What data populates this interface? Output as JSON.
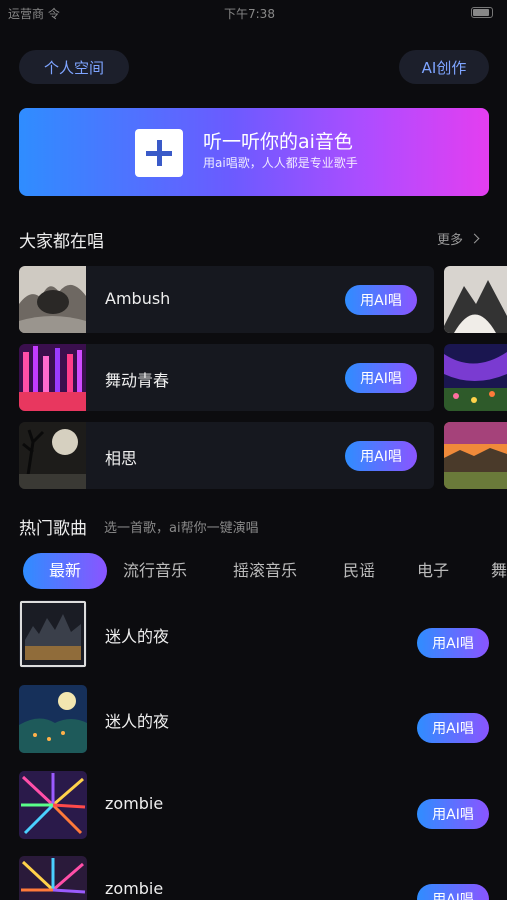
{
  "status_bar": {
    "carrier": "运营商 令",
    "time": "下午7:38"
  },
  "header": {
    "personal_space": "个人空间",
    "ai_create": "AI创作"
  },
  "banner": {
    "title": "听一听你的ai音色",
    "subtitle": "用ai唱歌，人人都是专业歌手",
    "icon": "plus-icon"
  },
  "everyone_singing": {
    "title": "大家都在唱",
    "more": "更多",
    "items": [
      {
        "name": "Ambush",
        "button": "用AI唱"
      },
      {
        "name": "舞动青春",
        "button": "用AI唱"
      },
      {
        "name": "相思",
        "button": "用AI唱"
      }
    ]
  },
  "hot_songs": {
    "title": "热门歌曲",
    "subtitle": "选一首歌，ai帮你一键演唱",
    "tabs": [
      "最新",
      "流行音乐",
      "摇滚音乐",
      "民谣",
      "电子",
      "舞"
    ],
    "active_tab": "最新",
    "items": [
      {
        "name": "迷人的夜",
        "button": "用AI唱"
      },
      {
        "name": "迷人的夜",
        "button": "用AI唱"
      },
      {
        "name": "zombie",
        "button": "用AI唱"
      },
      {
        "name": "zombie",
        "button": "用AI唱"
      }
    ]
  },
  "colors": {
    "background": "#0c0c0f",
    "accent_blue": "#2f8dff",
    "accent_purple": "#8a55ff",
    "banner_pink": "#e43ef0",
    "card_bg": "#16181f"
  }
}
